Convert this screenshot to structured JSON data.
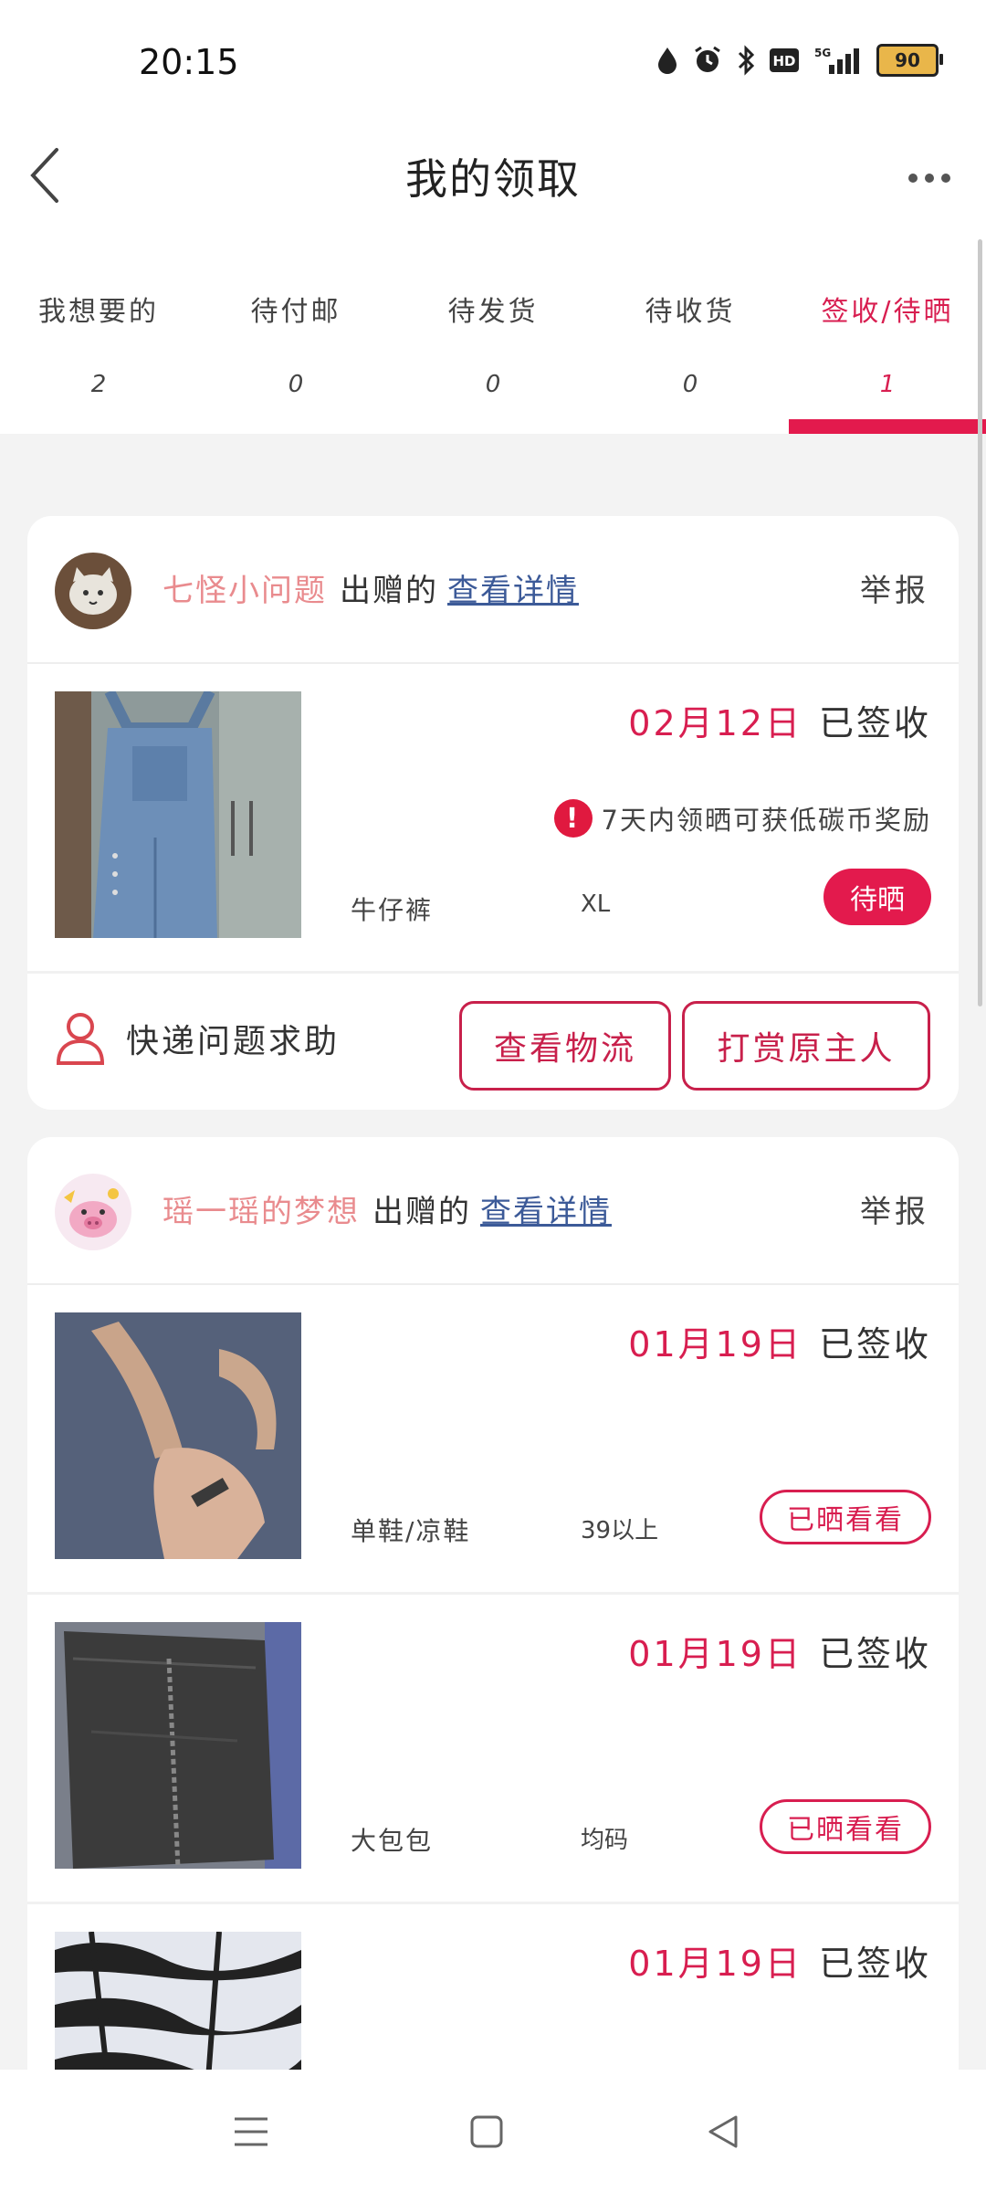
{
  "status": {
    "time": "20:15",
    "battery": "90"
  },
  "header": {
    "title": "我的领取"
  },
  "tabs": [
    {
      "label": "我想要的",
      "count": "2"
    },
    {
      "label": "待付邮",
      "count": "0"
    },
    {
      "label": "待发货",
      "count": "0"
    },
    {
      "label": "待收货",
      "count": "0"
    },
    {
      "label": "签收/待晒",
      "count": "1"
    }
  ],
  "cards": [
    {
      "giver": "七怪小问题",
      "given_suffix": "出赠的",
      "detail_link": "查看详情",
      "report": "举报",
      "items": [
        {
          "date": "02月12日",
          "status": "已签收",
          "notice": "7天内领晒可获低碳币奖励",
          "name": "牛仔裤",
          "size": "XL",
          "button": "待晒"
        }
      ],
      "actions": {
        "help": "快递问题求助",
        "logistics": "查看物流",
        "reward": "打赏原主人"
      }
    },
    {
      "giver": "瑶一瑶的梦想",
      "given_suffix": "出赠的",
      "detail_link": "查看详情",
      "report": "举报",
      "items": [
        {
          "date": "01月19日",
          "status": "已签收",
          "name": "单鞋/凉鞋",
          "size": "39以上",
          "button": "已晒看看"
        },
        {
          "date": "01月19日",
          "status": "已签收",
          "name": "大包包",
          "size": "均码",
          "button": "已晒看看"
        },
        {
          "date": "01月19日",
          "status": "已签收"
        }
      ]
    }
  ],
  "colors": {
    "accent": "#e31a4d",
    "giver": "#e98b8e",
    "link": "#3c5a98",
    "background": "#f3f3f3"
  }
}
